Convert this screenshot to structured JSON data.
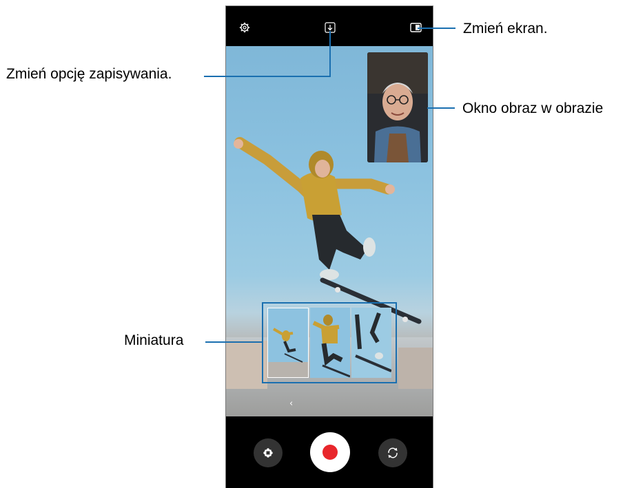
{
  "callouts": {
    "change_screen": "Zmień ekran.",
    "save_option": "Zmień opcję zapisywania.",
    "pip_window": "Okno obraz w obrazie",
    "thumbnail": "Miniatura"
  },
  "camera": {
    "top_icons": [
      "gear-icon",
      "download-icon",
      "screen-layout-icon"
    ],
    "bottom_icons": [
      "effects-icon",
      "record-icon",
      "switch-camera-icon"
    ],
    "chevron": "‹"
  },
  "colors": {
    "accent": "#1a6fb0",
    "record": "#e8262b"
  }
}
